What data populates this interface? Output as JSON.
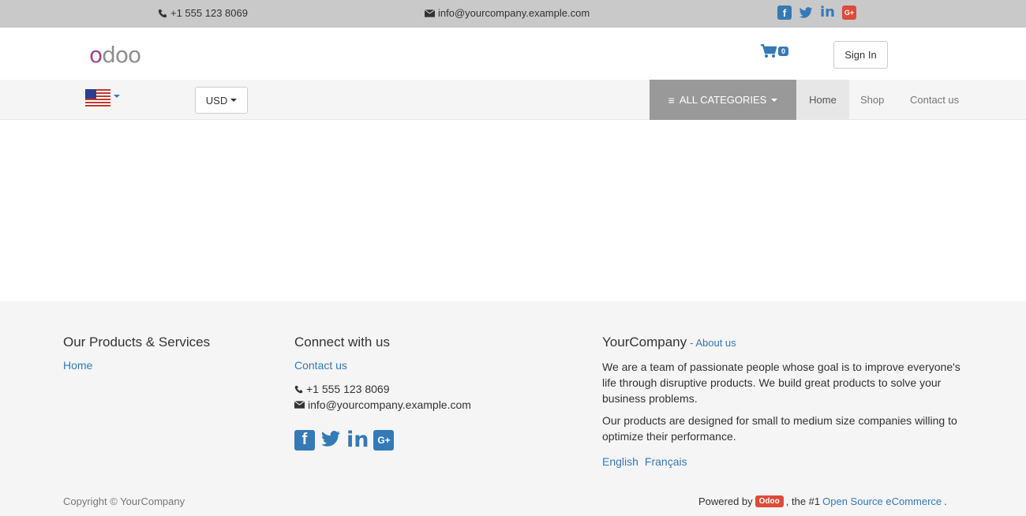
{
  "topbar": {
    "phone": "+1 555 123 8069",
    "email": "info@yourcompany.example.com",
    "socials": [
      "facebook-icon",
      "twitter-icon",
      "linkedin-icon",
      "google-plus-icon"
    ]
  },
  "header": {
    "logo": "odoo",
    "cart_count": "0",
    "signin_label": "Sign In"
  },
  "nav": {
    "currency": "USD",
    "all_categories": "ALL CATEGORIES",
    "links": [
      "Home",
      "Shop",
      "Contact us"
    ],
    "active": "Home"
  },
  "footer": {
    "col1": {
      "title": "Our Products & Services",
      "links": [
        "Home"
      ]
    },
    "col2": {
      "title": "Connect with us",
      "link": "Contact us",
      "phone": "+1 555 123 8069",
      "email": "info@yourcompany.example.com"
    },
    "col3": {
      "title": "YourCompany",
      "about": "- About us",
      "p1": "We are a team of passionate people whose goal is to improve everyone's life through disruptive products. We build great products to solve your business problems.",
      "p2": "Our products are designed for small to medium size companies willing to optimize their performance.",
      "langs": [
        "English",
        "Français"
      ]
    },
    "copyright": "Copyright © YourCompany",
    "powered_prefix": "Powered by",
    "powered_badge": "Odoo",
    "powered_mid": ", the #1",
    "powered_link": "Open Source eCommerce",
    "powered_suffix": "."
  },
  "colors": {
    "link": "#337ab7",
    "topbar": "#c9c9c9",
    "nav_bg": "#f5f5f5",
    "categories_bg": "#999999",
    "gplus": "#dd4b39"
  }
}
